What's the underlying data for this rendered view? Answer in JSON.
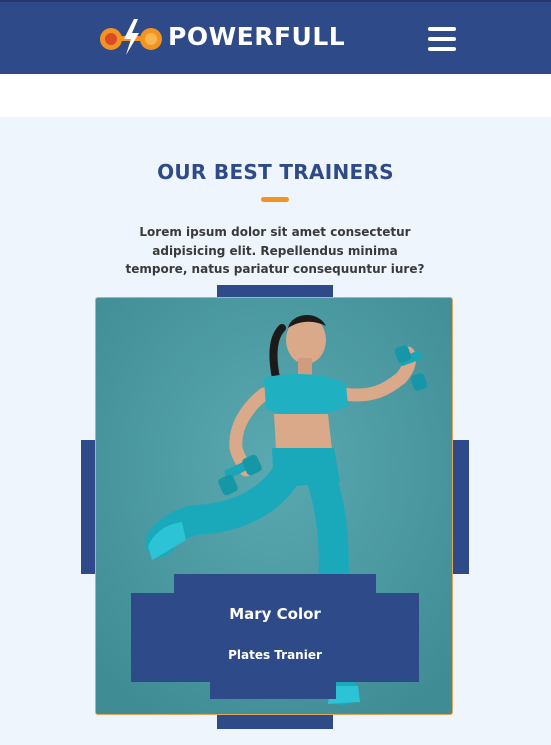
{
  "header": {
    "brand": "POWERFULL",
    "logo_icon": "dumbbell-lightning-logo",
    "menu_icon": "hamburger-menu-icon",
    "background": "#2f4a88"
  },
  "trainers": {
    "title": "OUR BEST TRAINERS",
    "accent_color": "#f39322",
    "intro": "Lorem ipsum dolor sit amet consectetur adipisicing elit. Repellendus minima tempore, natus pariatur consequuntur iure?",
    "card": {
      "name": "Mary Color",
      "role": "Plates Tranier"
    }
  }
}
